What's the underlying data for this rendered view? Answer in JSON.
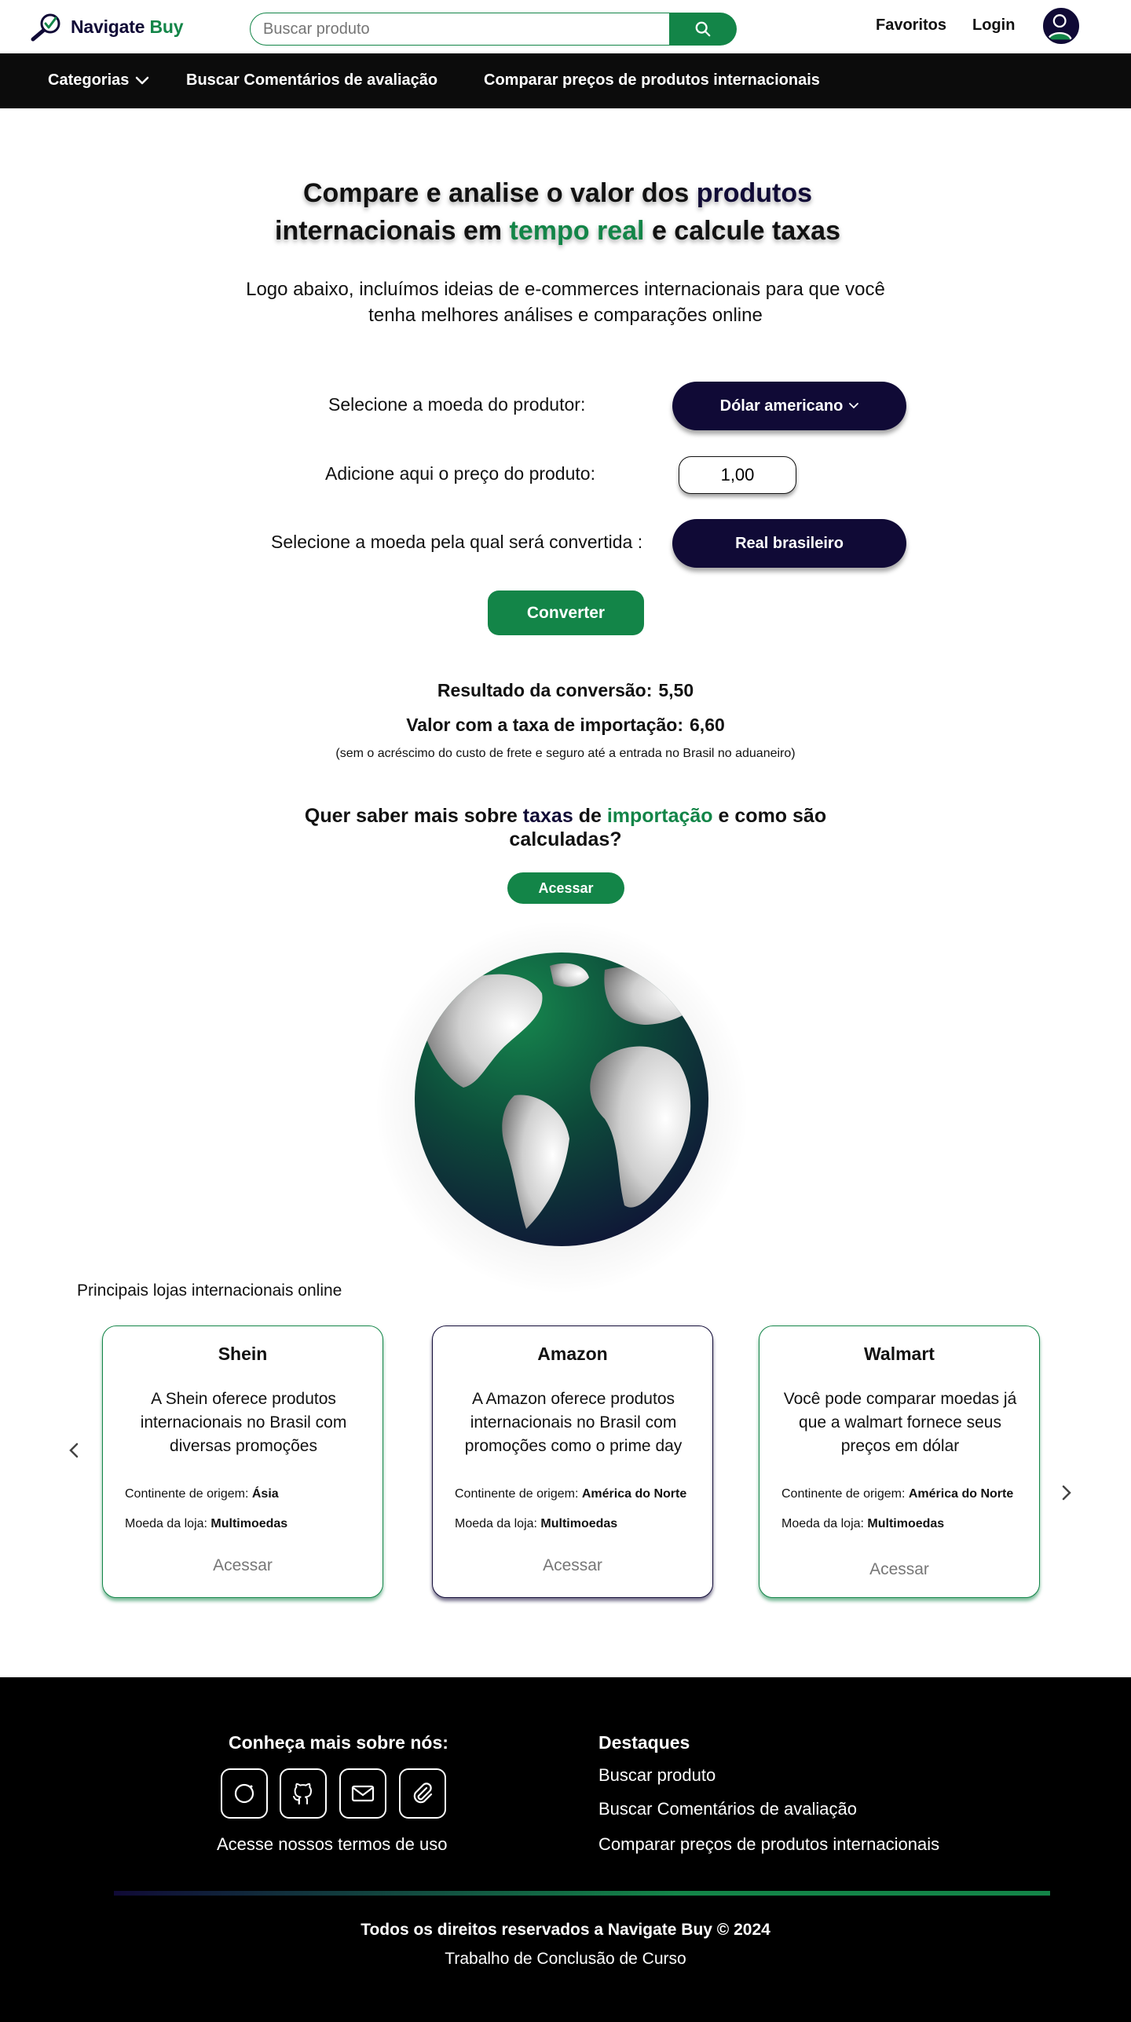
{
  "header": {
    "logo_part1": "Navigate",
    "logo_part2": "Buy",
    "search_placeholder": "Buscar produto",
    "favoritos": "Favoritos",
    "login": "Login"
  },
  "nav": {
    "categorias": "Categorias",
    "comentarios": "Buscar Comentários de avaliação",
    "comparar": "Comparar preços de produtos internacionais"
  },
  "hero": {
    "title_a": "Compare e analise o valor dos ",
    "title_b": "produtos",
    "title_c": "internacionais em ",
    "title_d": "tempo real ",
    "title_e": " e calcule taxas",
    "subtitle": "Logo abaixo, incluímos ideias de e-commerces internacionais para que você tenha melhores análises e comparações online"
  },
  "converter": {
    "label_source": "Selecione a moeda do produtor:",
    "source_currency": "Dólar americano",
    "label_price": "Adicione aqui o preço do produto:",
    "price_value": "1,00",
    "label_target": "Selecione a moeda pela qual será convertida :",
    "target_currency": "Real brasileiro",
    "button": "Converter",
    "result_label": "Resultado da conversão:",
    "result_value": "5,50",
    "tax_label": "Valor com a taxa de importação:",
    "tax_value": "6,60",
    "note": "(sem o acréscimo do custo de frete e seguro até a entrada no Brasil no aduaneiro)"
  },
  "tax_info": {
    "q_a": "Quer saber mais sobre ",
    "q_b": "taxas",
    "q_c": " de ",
    "q_d": "importação",
    "q_e": " e como são calculadas?",
    "button": "Acessar"
  },
  "stores": {
    "title": "Principais lojas internacionais online",
    "meta_continent_label": "Continente de origem: ",
    "meta_currency_label": "Moeda da loja: ",
    "items": [
      {
        "name": "Shein",
        "description": "A Shein oferece produtos internacionais no Brasil com diversas promoções",
        "continent": "Ásia",
        "currency": "Multimoedas",
        "link": "Acessar"
      },
      {
        "name": "Amazon",
        "description": "A Amazon oferece produtos internacionais no Brasil com promoções como o prime day",
        "continent": "América do Norte",
        "currency": "Multimoedas",
        "link": "Acessar"
      },
      {
        "name": "Walmart",
        "description": "Você pode comparar moedas já que a walmart fornece seus preços em dólar",
        "continent": "América do Norte",
        "currency": "Multimoedas",
        "link": "Acessar"
      }
    ]
  },
  "footer": {
    "about_title": "Conheça mais sobre nós:",
    "terms": "Acesse nossos termos de uso",
    "highlights_title": "Destaques",
    "links": [
      "Buscar produto",
      "Buscar Comentários de avaliação",
      "Comparar preços de produtos internacionais"
    ],
    "copyright": "Todos os direitos reservados a Navigate Buy © 2024",
    "tcc": "Trabalho de Conclusão de Curso"
  },
  "colors": {
    "navy": "#100a36",
    "green": "#138548",
    "black": "#000000"
  }
}
